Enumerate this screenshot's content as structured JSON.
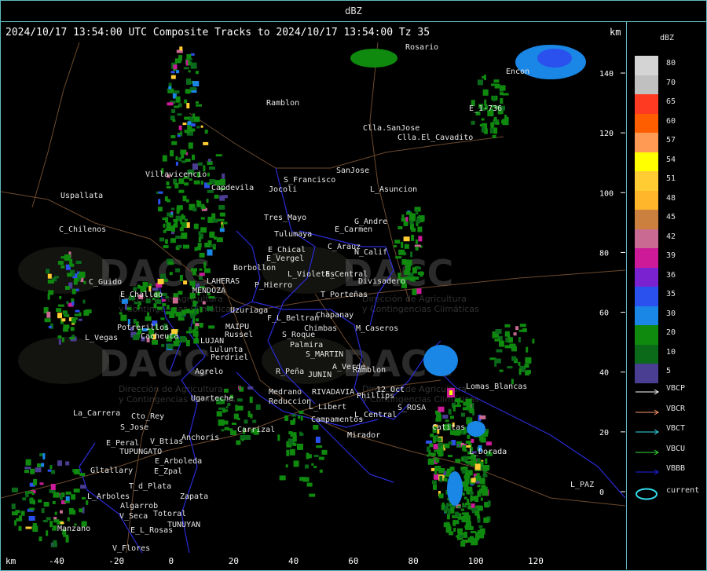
{
  "window": {
    "title": "dBZ"
  },
  "map": {
    "title": "2024/10/17 13:54:00 UTC Composite Tracks to 2024/10/17 13:54:00 Tz 35",
    "unit_top": "km",
    "unit_bottom": "km",
    "x_axis_labels": [
      "-40",
      "-20",
      "0",
      "20",
      "40",
      "60",
      "80",
      "100",
      "120"
    ],
    "y_axis_labels": [
      "140",
      "120",
      "100",
      "80",
      "60",
      "40",
      "20",
      "0"
    ],
    "watermarks": [
      {
        "text": "DACC",
        "sub_lines": [
          "Dirección de Agricultura",
          "y Contingencias Climáticas"
        ]
      },
      {
        "text": "DACC",
        "sub_lines": [
          "Dirección de Agricultura",
          "y Contingencias Climáticas"
        ]
      },
      {
        "text": "DACC",
        "sub_lines": [
          "Dirección de Agricultura",
          "y Contingencias Climáticas"
        ]
      }
    ],
    "places": [
      "Rosario",
      "Encon",
      "Ramblon",
      "E_1-736",
      "Clla.SanJose",
      "Clla.El_Cavadito",
      "Uspallata",
      "Villavicencio",
      "Capdevila",
      "Jocoli",
      "S_Francisco",
      "SanJose",
      "L_Asuncion",
      "C_Chilenos",
      "Tres_Mayo",
      "Tulumaya",
      "G_Andre",
      "E_Carmen",
      "E_Chical",
      "C_Arauz",
      "E_Vergel",
      "N_Calif",
      "Borbollon",
      "L_Violetas",
      "E_Central",
      "Divisadero",
      "C_Guido",
      "LAHERAS",
      "P_Hierro",
      "E_Challao",
      "MENDOZA",
      "T_Porteñas",
      "Uzuriaga",
      "Chapanay",
      "Potrerillos",
      "MAIPU",
      "F_L_Beltran",
      "Chimbas",
      "M_Caseros",
      "L_Vegas",
      "Cacheuta",
      "Russel",
      "S_Roque",
      "Palmira",
      "LUJAN",
      "S_MARTIN",
      "Luluntа",
      "Perdriel",
      "A_Verde",
      "Agrelo",
      "R_Peña",
      "JUNIN",
      "Ramblon",
      "Medrano",
      "RIVADAVIA",
      "Phillips",
      "12_Oct",
      "Lomas_Blancas",
      "Ugarteche",
      "Reduccion",
      "L_Libert",
      "La_Carrera",
      "Cto_Rey",
      "L_Central",
      "S_ROSA",
      "S_Jose",
      "Campamentos",
      "Catitas",
      "Carrizal",
      "Mirador",
      "E_Peral",
      "V_Btias",
      "Anchoris",
      "TUPUNGATO",
      "L_Dorada",
      "E_Arboleda",
      "Gltallary",
      "E_Zpal",
      "L_PAZ",
      "T_d_Plata",
      "L_Arboles",
      "Zapata",
      "Algarrob",
      "Totoral",
      "V_Seca",
      "Manzano",
      "E_L_Rosas",
      "TUNUYAN",
      "V_Flores"
    ]
  },
  "legend": {
    "title": "dBZ",
    "scale": [
      {
        "label": "80",
        "color": "#d4d4d4"
      },
      {
        "label": "70",
        "color": "#c0c0c0"
      },
      {
        "label": "65",
        "color": "#ff3a22"
      },
      {
        "label": "60",
        "color": "#ff5e00"
      },
      {
        "label": "57",
        "color": "#ff9a55"
      },
      {
        "label": "54",
        "color": "#ffff00"
      },
      {
        "label": "51",
        "color": "#ffcc33"
      },
      {
        "label": "48",
        "color": "#ffb62a"
      },
      {
        "label": "45",
        "color": "#cc8040"
      },
      {
        "label": "42",
        "color": "#c96a92"
      },
      {
        "label": "39",
        "color": "#cc1a99"
      },
      {
        "label": "36",
        "color": "#7a22d0"
      },
      {
        "label": "35",
        "color": "#2a50ee"
      },
      {
        "label": "30",
        "color": "#1a86e6"
      },
      {
        "label": "20",
        "color": "#0f8a0f"
      },
      {
        "label": "10",
        "color": "#0a6a1a"
      },
      {
        "label": "5",
        "color": "#4a3e92"
      }
    ],
    "tracks": [
      {
        "label": "VBCP",
        "color": "#ffffff"
      },
      {
        "label": "VBCR",
        "color": "#ff9a6a"
      },
      {
        "label": "VBCT",
        "color": "#33ddee"
      },
      {
        "label": "VBCU",
        "color": "#33dd33"
      },
      {
        "label": "VBBB",
        "color": "#2222ee"
      }
    ],
    "current": {
      "label": "current",
      "color": "#33ddee"
    }
  }
}
